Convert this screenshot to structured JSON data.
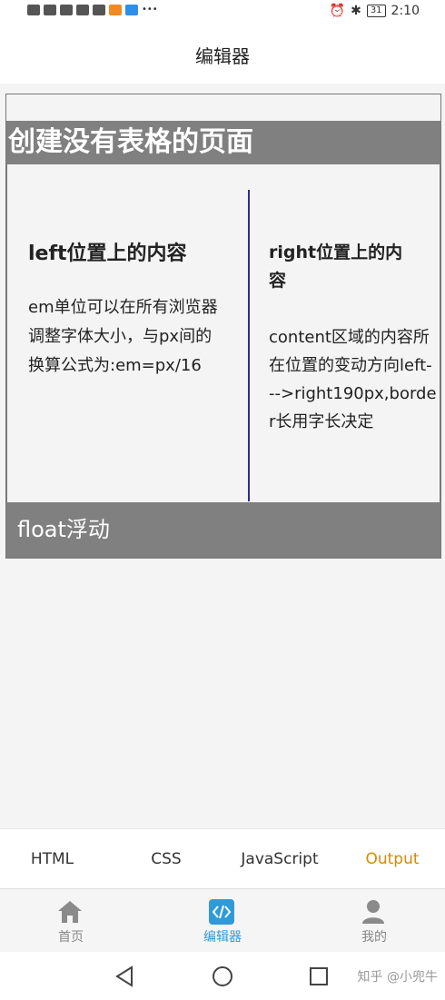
{
  "status_bar": {
    "left_icons": [
      "hd-icon",
      "signal-icon",
      "wifi-icon",
      "message-icon",
      "translate-icon",
      "video-icon",
      "browser-icon",
      "more-icon"
    ],
    "battery": "31",
    "time": "2:10"
  },
  "header": {
    "title": "编辑器"
  },
  "preview": {
    "page_heading": "创建没有表格的页面",
    "left": {
      "heading": "left位置上的内容",
      "text": "em单位可以在所有浏览器调整字体大小，与px间的换算公式为:em=px/16"
    },
    "right": {
      "heading": "right位置上的内容",
      "text": "content区域的内容所在位置的变动方向left--->right190px,border长用字长决定"
    },
    "footer": "float浮动"
  },
  "tabs": [
    {
      "label": "HTML",
      "active": false
    },
    {
      "label": "CSS",
      "active": false
    },
    {
      "label": "JavaScript",
      "active": false
    },
    {
      "label": "Output",
      "active": true
    }
  ],
  "bottom_nav": [
    {
      "label": "首页",
      "icon": "home-icon",
      "active": false
    },
    {
      "label": "编辑器",
      "icon": "code-icon",
      "active": true
    },
    {
      "label": "我的",
      "icon": "user-icon",
      "active": false
    }
  ],
  "system_nav": {
    "icons": [
      "back-icon",
      "home-circle-icon",
      "recent-apps-icon"
    ],
    "watermark": "知乎 @小兜牛"
  },
  "colors": {
    "accent_tab": "#d58a08",
    "accent_nav": "#2f9ad8",
    "preview_bar": "#808080",
    "divider": "#2c2c8c"
  }
}
